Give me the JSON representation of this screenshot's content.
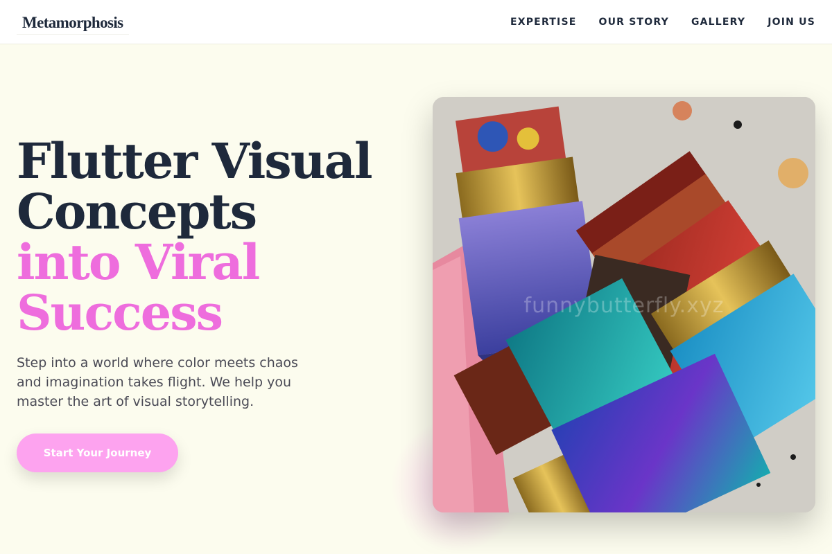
{
  "brand": {
    "logo": "Metamorphosis"
  },
  "nav": {
    "items": [
      {
        "label": "EXPERTISE"
      },
      {
        "label": "OUR STORY"
      },
      {
        "label": "GALLERY"
      },
      {
        "label": "JOIN US"
      }
    ]
  },
  "hero": {
    "title_lines": [
      {
        "text": "Flutter Visual"
      },
      {
        "text": "Concepts"
      },
      {
        "text": "into Viral"
      },
      {
        "text": "Success"
      }
    ],
    "description": "Step into a world where color meets chaos and imagination takes flight. We help you master the art of visual storytelling.",
    "cta_label": "Start Your Journey",
    "image": {
      "subject": "paint-brushes-photo",
      "watermark": "funnybutterfly.xyz"
    }
  },
  "colors": {
    "accent_pink": "#ee6ddd",
    "button_pink": "#fda3ef",
    "text_dark": "#1e293b",
    "background": "#fcfcee"
  }
}
